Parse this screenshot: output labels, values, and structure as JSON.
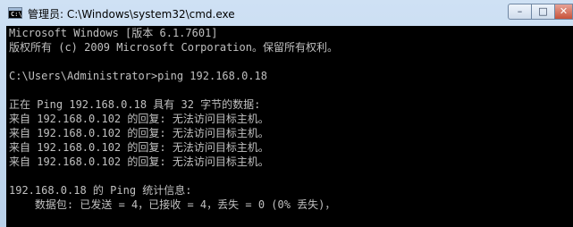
{
  "window": {
    "title": "管理员: C:\\Windows\\system32\\cmd.exe",
    "app_icon_text": "C:\\",
    "controls": {
      "minimize": "–",
      "maximize": "□",
      "close": "✕"
    }
  },
  "console": {
    "lines": [
      "Microsoft Windows [版本 6.1.7601]",
      "版权所有 (c) 2009 Microsoft Corporation。保留所有权利。",
      "",
      "C:\\Users\\Administrator>ping 192.168.0.18",
      "",
      "正在 Ping 192.168.0.18 具有 32 字节的数据:",
      "来自 192.168.0.102 的回复: 无法访问目标主机。",
      "来自 192.168.0.102 的回复: 无法访问目标主机。",
      "来自 192.168.0.102 的回复: 无法访问目标主机。",
      "来自 192.168.0.102 的回复: 无法访问目标主机。",
      "",
      "192.168.0.18 的 Ping 统计信息:",
      "    数据包: 已发送 = 4，已接收 = 4，丢失 = 0 (0% 丢失)，"
    ]
  }
}
